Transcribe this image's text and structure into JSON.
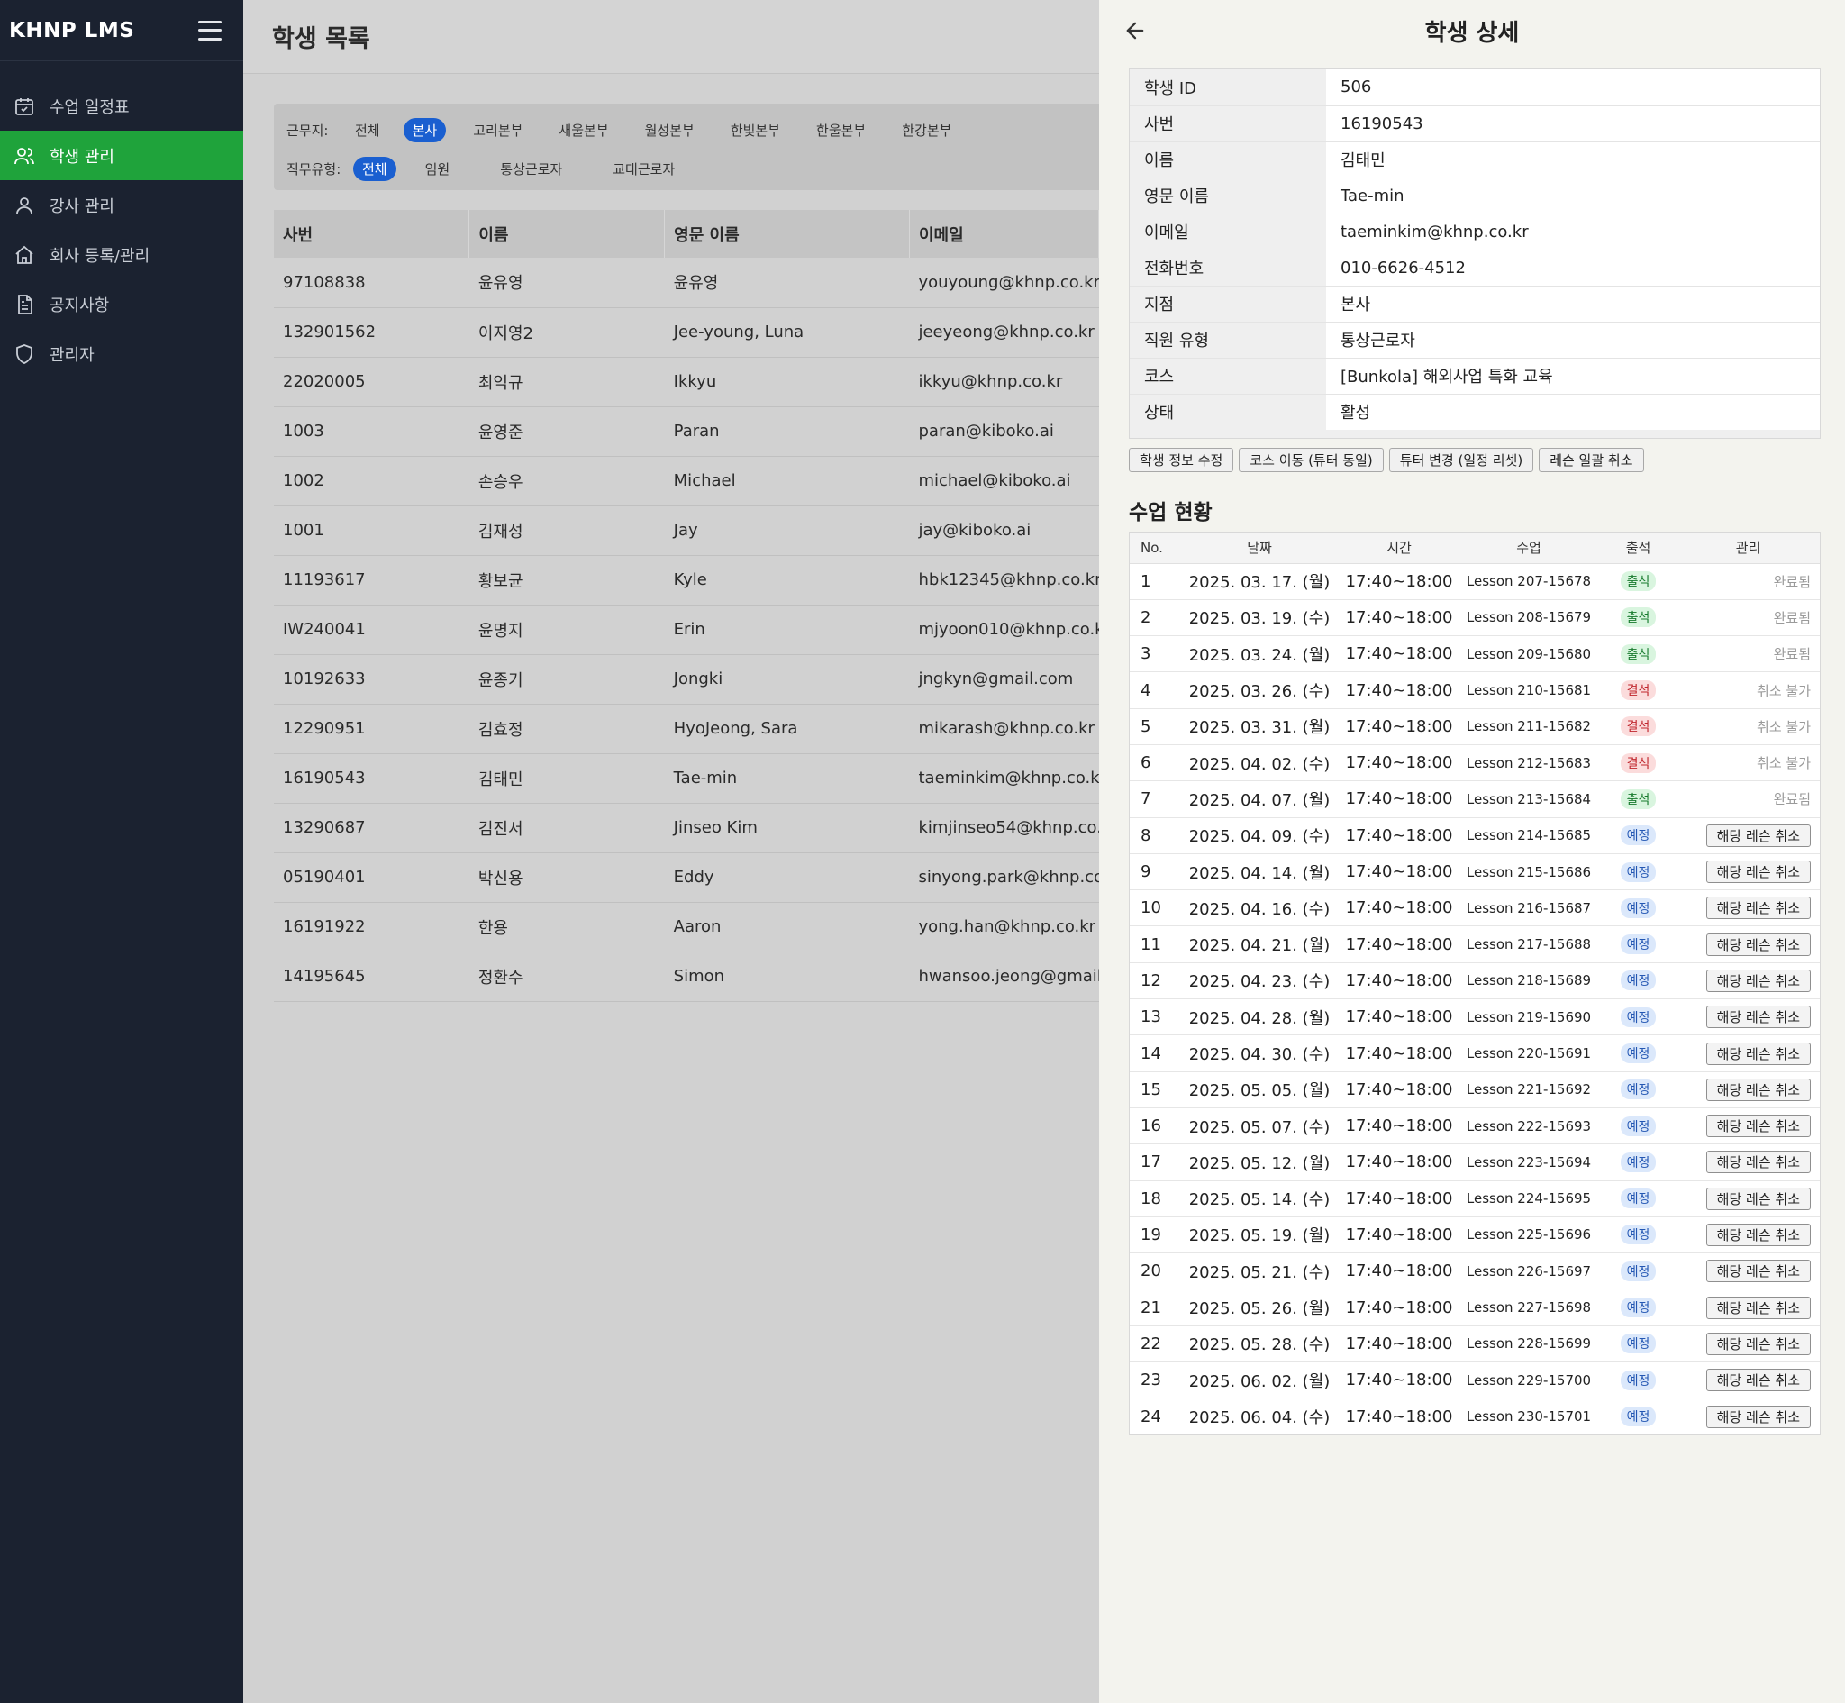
{
  "sidebar": {
    "brand": "KHNP LMS",
    "items": [
      {
        "label": "수업 일정표",
        "icon": "calendar-icon",
        "active": false
      },
      {
        "label": "학생 관리",
        "icon": "users-icon",
        "active": true
      },
      {
        "label": "강사 관리",
        "icon": "user-icon",
        "active": false
      },
      {
        "label": "회사 등록/관리",
        "icon": "home-icon",
        "active": false
      },
      {
        "label": "공지사항",
        "icon": "document-icon",
        "active": false
      },
      {
        "label": "관리자",
        "icon": "shield-icon",
        "active": false
      }
    ]
  },
  "main": {
    "title": "학생 목록",
    "filters": {
      "location_label": "근무지:",
      "locations": [
        "전체",
        "본사",
        "고리본부",
        "새울본부",
        "월성본부",
        "한빛본부",
        "한울본부",
        "한강본부"
      ],
      "location_selected": "본사",
      "jobtype_label": "직무유형:",
      "jobtypes": [
        "전체",
        "임원",
        "통상근로자",
        "교대근로자"
      ],
      "jobtype_selected": "전체"
    },
    "table": {
      "headers": [
        "사번",
        "이름",
        "영문 이름",
        "이메일"
      ],
      "rows": [
        [
          "97108838",
          "윤유영",
          "윤유영",
          "youyoung@khnp.co.kr"
        ],
        [
          "132901562",
          "이지영2",
          "Jee-young, Luna",
          "jeeyeong@khnp.co.kr"
        ],
        [
          "22020005",
          "최익규",
          "Ikkyu",
          "ikkyu@khnp.co.kr"
        ],
        [
          "1003",
          "윤영준",
          "Paran",
          "paran@kiboko.ai"
        ],
        [
          "1002",
          "손승우",
          "Michael",
          "michael@kiboko.ai"
        ],
        [
          "1001",
          "김재성",
          "Jay",
          "jay@kiboko.ai"
        ],
        [
          "11193617",
          "황보균",
          "Kyle",
          "hbk12345@khnp.co.kr"
        ],
        [
          "IW240041",
          "윤명지",
          "Erin",
          "mjyoon010@khnp.co.k"
        ],
        [
          "10192633",
          "윤종기",
          "Jongki",
          "jngkyn@gmail.com"
        ],
        [
          "12290951",
          "김효정",
          "HyoJeong, Sara",
          "mikarash@khnp.co.kr"
        ],
        [
          "16190543",
          "김태민",
          "Tae-min",
          "taeminkim@khnp.co.kr"
        ],
        [
          "13290687",
          "김진서",
          "Jinseo Kim",
          "kimjinseo54@khnp.co."
        ],
        [
          "05190401",
          "박신용",
          "Eddy",
          "sinyong.park@khnp.co"
        ],
        [
          "16191922",
          "한용",
          "Aaron",
          "yong.han@khnp.co.kr"
        ],
        [
          "14195645",
          "정환수",
          "Simon",
          "hwansoo.jeong@gmail"
        ]
      ]
    }
  },
  "detail": {
    "title": "학생 상세",
    "info": [
      {
        "label": "학생 ID",
        "value": "506"
      },
      {
        "label": "사번",
        "value": "16190543"
      },
      {
        "label": "이름",
        "value": "김태민"
      },
      {
        "label": "영문 이름",
        "value": "Tae-min"
      },
      {
        "label": "이메일",
        "value": "taeminkim@khnp.co.kr"
      },
      {
        "label": "전화번호",
        "value": "010-6626-4512"
      },
      {
        "label": "지점",
        "value": "본사"
      },
      {
        "label": "직원 유형",
        "value": "통상근로자"
      },
      {
        "label": "코스",
        "value": "[Bunkola] 해외사업 특화 교육"
      },
      {
        "label": "상태",
        "value": "활성"
      }
    ],
    "actions": [
      "학생 정보 수정",
      "코스 이동 (튜터 동일)",
      "튜터 변경 (일정 리셋)",
      "레슨 일괄 취소"
    ],
    "lessons_title": "수업 현황",
    "lesson_headers": [
      "No.",
      "날짜",
      "시간",
      "수업",
      "출석",
      "관리"
    ],
    "lessons": [
      {
        "no": "1",
        "date": "2025. 03. 17. (월)",
        "time": "17:40~18:00",
        "lesson": "Lesson 207-15678",
        "att": "출석",
        "att_type": "att",
        "mgmt": "완료됨",
        "mgmt_type": "text"
      },
      {
        "no": "2",
        "date": "2025. 03. 19. (수)",
        "time": "17:40~18:00",
        "lesson": "Lesson 208-15679",
        "att": "출석",
        "att_type": "att",
        "mgmt": "완료됨",
        "mgmt_type": "text"
      },
      {
        "no": "3",
        "date": "2025. 03. 24. (월)",
        "time": "17:40~18:00",
        "lesson": "Lesson 209-15680",
        "att": "출석",
        "att_type": "att",
        "mgmt": "완료됨",
        "mgmt_type": "text"
      },
      {
        "no": "4",
        "date": "2025. 03. 26. (수)",
        "time": "17:40~18:00",
        "lesson": "Lesson 210-15681",
        "att": "결석",
        "att_type": "abs",
        "mgmt": "취소 불가",
        "mgmt_type": "text"
      },
      {
        "no": "5",
        "date": "2025. 03. 31. (월)",
        "time": "17:40~18:00",
        "lesson": "Lesson 211-15682",
        "att": "결석",
        "att_type": "abs",
        "mgmt": "취소 불가",
        "mgmt_type": "text"
      },
      {
        "no": "6",
        "date": "2025. 04. 02. (수)",
        "time": "17:40~18:00",
        "lesson": "Lesson 212-15683",
        "att": "결석",
        "att_type": "abs",
        "mgmt": "취소 불가",
        "mgmt_type": "text"
      },
      {
        "no": "7",
        "date": "2025. 04. 07. (월)",
        "time": "17:40~18:00",
        "lesson": "Lesson 213-15684",
        "att": "출석",
        "att_type": "att",
        "mgmt": "완료됨",
        "mgmt_type": "text"
      },
      {
        "no": "8",
        "date": "2025. 04. 09. (수)",
        "time": "17:40~18:00",
        "lesson": "Lesson 214-15685",
        "att": "예정",
        "att_type": "sch",
        "mgmt": "해당 레슨 취소",
        "mgmt_type": "button"
      },
      {
        "no": "9",
        "date": "2025. 04. 14. (월)",
        "time": "17:40~18:00",
        "lesson": "Lesson 215-15686",
        "att": "예정",
        "att_type": "sch",
        "mgmt": "해당 레슨 취소",
        "mgmt_type": "button"
      },
      {
        "no": "10",
        "date": "2025. 04. 16. (수)",
        "time": "17:40~18:00",
        "lesson": "Lesson 216-15687",
        "att": "예정",
        "att_type": "sch",
        "mgmt": "해당 레슨 취소",
        "mgmt_type": "button"
      },
      {
        "no": "11",
        "date": "2025. 04. 21. (월)",
        "time": "17:40~18:00",
        "lesson": "Lesson 217-15688",
        "att": "예정",
        "att_type": "sch",
        "mgmt": "해당 레슨 취소",
        "mgmt_type": "button"
      },
      {
        "no": "12",
        "date": "2025. 04. 23. (수)",
        "time": "17:40~18:00",
        "lesson": "Lesson 218-15689",
        "att": "예정",
        "att_type": "sch",
        "mgmt": "해당 레슨 취소",
        "mgmt_type": "button"
      },
      {
        "no": "13",
        "date": "2025. 04. 28. (월)",
        "time": "17:40~18:00",
        "lesson": "Lesson 219-15690",
        "att": "예정",
        "att_type": "sch",
        "mgmt": "해당 레슨 취소",
        "mgmt_type": "button"
      },
      {
        "no": "14",
        "date": "2025. 04. 30. (수)",
        "time": "17:40~18:00",
        "lesson": "Lesson 220-15691",
        "att": "예정",
        "att_type": "sch",
        "mgmt": "해당 레슨 취소",
        "mgmt_type": "button"
      },
      {
        "no": "15",
        "date": "2025. 05. 05. (월)",
        "time": "17:40~18:00",
        "lesson": "Lesson 221-15692",
        "att": "예정",
        "att_type": "sch",
        "mgmt": "해당 레슨 취소",
        "mgmt_type": "button"
      },
      {
        "no": "16",
        "date": "2025. 05. 07. (수)",
        "time": "17:40~18:00",
        "lesson": "Lesson 222-15693",
        "att": "예정",
        "att_type": "sch",
        "mgmt": "해당 레슨 취소",
        "mgmt_type": "button"
      },
      {
        "no": "17",
        "date": "2025. 05. 12. (월)",
        "time": "17:40~18:00",
        "lesson": "Lesson 223-15694",
        "att": "예정",
        "att_type": "sch",
        "mgmt": "해당 레슨 취소",
        "mgmt_type": "button"
      },
      {
        "no": "18",
        "date": "2025. 05. 14. (수)",
        "time": "17:40~18:00",
        "lesson": "Lesson 224-15695",
        "att": "예정",
        "att_type": "sch",
        "mgmt": "해당 레슨 취소",
        "mgmt_type": "button"
      },
      {
        "no": "19",
        "date": "2025. 05. 19. (월)",
        "time": "17:40~18:00",
        "lesson": "Lesson 225-15696",
        "att": "예정",
        "att_type": "sch",
        "mgmt": "해당 레슨 취소",
        "mgmt_type": "button"
      },
      {
        "no": "20",
        "date": "2025. 05. 21. (수)",
        "time": "17:40~18:00",
        "lesson": "Lesson 226-15697",
        "att": "예정",
        "att_type": "sch",
        "mgmt": "해당 레슨 취소",
        "mgmt_type": "button"
      },
      {
        "no": "21",
        "date": "2025. 05. 26. (월)",
        "time": "17:40~18:00",
        "lesson": "Lesson 227-15698",
        "att": "예정",
        "att_type": "sch",
        "mgmt": "해당 레슨 취소",
        "mgmt_type": "button"
      },
      {
        "no": "22",
        "date": "2025. 05. 28. (수)",
        "time": "17:40~18:00",
        "lesson": "Lesson 228-15699",
        "att": "예정",
        "att_type": "sch",
        "mgmt": "해당 레슨 취소",
        "mgmt_type": "button"
      },
      {
        "no": "23",
        "date": "2025. 06. 02. (월)",
        "time": "17:40~18:00",
        "lesson": "Lesson 229-15700",
        "att": "예정",
        "att_type": "sch",
        "mgmt": "해당 레슨 취소",
        "mgmt_type": "button"
      },
      {
        "no": "24",
        "date": "2025. 06. 04. (수)",
        "time": "17:40~18:00",
        "lesson": "Lesson 230-15701",
        "att": "예정",
        "att_type": "sch",
        "mgmt": "해당 레슨 취소",
        "mgmt_type": "button"
      }
    ]
  },
  "colors": {
    "sidebar_bg": "#1b2230",
    "sidebar_active": "#1fa33b",
    "chip_active": "#1a5fd0",
    "attend": "#177a2d",
    "absent": "#c0262d",
    "scheduled": "#2457b3"
  }
}
